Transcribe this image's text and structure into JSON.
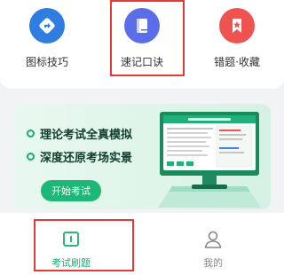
{
  "quick_actions": [
    {
      "label": "图标技巧",
      "icon": "compass-arrow-icon",
      "color": "#2f7de1"
    },
    {
      "label": "速记口诀",
      "icon": "book-icon",
      "color": "#5b6ee8"
    },
    {
      "label": "错题·收藏",
      "icon": "bookmark-star-icon",
      "color": "#ef5350"
    }
  ],
  "banner": {
    "features": [
      "理论考试全真模拟",
      "深度还原考场实景"
    ],
    "start_label": "开始考试",
    "accent_color": "#1db877"
  },
  "tabbar": {
    "tabs": [
      {
        "label": "考试刷题",
        "icon": "exam-book-icon",
        "active": true
      },
      {
        "label": "我的",
        "icon": "person-icon",
        "active": false
      }
    ],
    "active_color": "#1aab6e",
    "inactive_color": "#888888"
  },
  "highlight_color": "#e53935"
}
